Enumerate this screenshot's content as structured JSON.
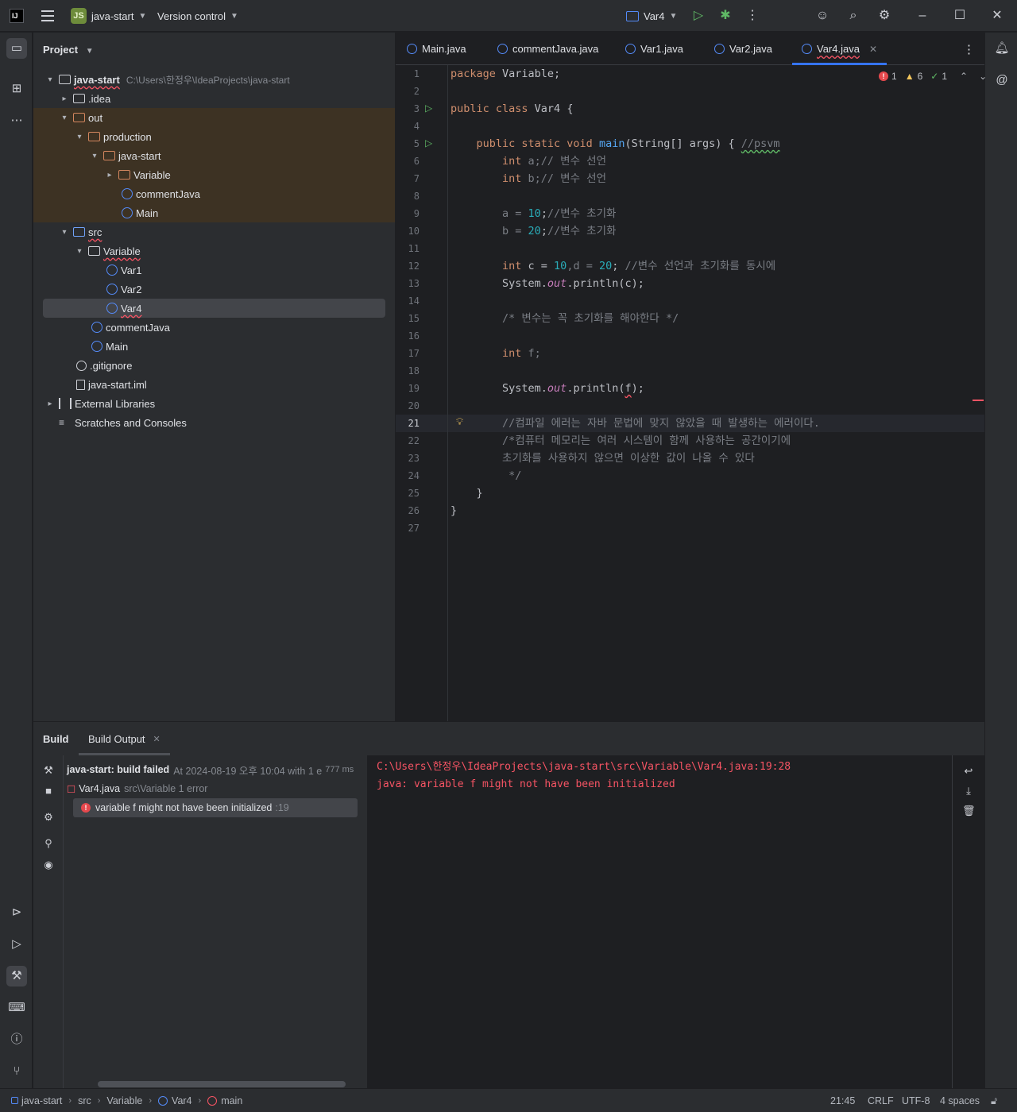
{
  "titlebar": {
    "app_logo": "IJ",
    "project_badge": "JS",
    "project_name": "java-start",
    "vcs_label": "Version control",
    "run_config": "Var4"
  },
  "project_panel": {
    "header": "Project",
    "root_name": "java-start",
    "root_path": "C:\\Users\\한정우\\IdeaProjects\\java-start",
    "items": [
      {
        "label": ".idea",
        "type": "folder"
      },
      {
        "label": "out",
        "type": "folder"
      },
      {
        "label": "production",
        "type": "folder"
      },
      {
        "label": "java-start",
        "type": "folder"
      },
      {
        "label": "Variable",
        "type": "folder"
      },
      {
        "label": "commentJava",
        "type": "class"
      },
      {
        "label": "Main",
        "type": "class"
      },
      {
        "label": "src",
        "type": "folder"
      },
      {
        "label": "Variable",
        "type": "package"
      },
      {
        "label": "Var1",
        "type": "class"
      },
      {
        "label": "Var2",
        "type": "class"
      },
      {
        "label": "Var4",
        "type": "class"
      },
      {
        "label": "commentJava",
        "type": "class"
      },
      {
        "label": "Main",
        "type": "class"
      },
      {
        "label": ".gitignore",
        "type": "file"
      },
      {
        "label": "java-start.iml",
        "type": "file"
      },
      {
        "label": "External Libraries",
        "type": "library"
      },
      {
        "label": "Scratches and Consoles",
        "type": "scratches"
      }
    ]
  },
  "editor": {
    "tabs": [
      "Main.java",
      "commentJava.java",
      "Var1.java",
      "Var2.java",
      "Var4.java"
    ],
    "active_tab": "Var4.java",
    "inspections": {
      "errors": "1",
      "warnings": "6",
      "ok": "1"
    },
    "line_numbers": [
      "1",
      "2",
      "3",
      "4",
      "5",
      "6",
      "7",
      "8",
      "9",
      "10",
      "11",
      "12",
      "13",
      "14",
      "15",
      "16",
      "17",
      "18",
      "19",
      "20",
      "21",
      "22",
      "23",
      "24",
      "25",
      "26",
      "27"
    ],
    "current_line": "21",
    "code": {
      "l1_a": "package",
      "l1_b": " Variable;",
      "l3_a": "public class",
      "l3_b": " Var4 {",
      "l5_a": "    public static void ",
      "l5_b": "main",
      "l5_c": "(String[] args) { ",
      "l5_d": "//psvm",
      "l6_a": "        int",
      "l6_b": " a;",
      "l6_c": "// 변수 선언",
      "l7_a": "        int",
      "l7_b": " b;",
      "l7_c": "// 변수 선언",
      "l9_a": "        a = ",
      "l9_b": "10",
      "l9_c": ";",
      "l9_d": "//변수 초기화",
      "l10_a": "        b = ",
      "l10_b": "20",
      "l10_c": ";",
      "l10_d": "//변수 초기화",
      "l12_a": "        int",
      "l12_b": " c = ",
      "l12_c": "10",
      "l12_d": ",d = ",
      "l12_e": "20",
      "l12_f": "; ",
      "l12_g": "//변수 선언과 초기화를 동시에",
      "l13_a": "        System.",
      "l13_b": "out",
      "l13_c": ".println(c);",
      "l15": "        /* 변수는 꼭 초기화를 해야한다 */",
      "l17_a": "        int",
      "l17_b": " f;",
      "l19_a": "        System.",
      "l19_b": "out",
      "l19_c": ".println(",
      "l19_d": "f",
      "l19_e": ");",
      "l21": "        //컴파일 에러는 자바 문법에 맞지 않았을 때 발생하는 에러이다.",
      "l22": "        /*컴퓨터 메모리는 여러 시스템이 함께 사용하는 공간이기에",
      "l23": "        초기화를 사용하지 않으면 이상한 값이 나올 수 있다",
      "l24": "         */",
      "l25": "    }",
      "l26": "}"
    }
  },
  "build": {
    "tab_build": "Build",
    "tab_output": "Build Output",
    "summary_title": "java-start: build failed",
    "summary_detail": "At 2024-08-19 오후 10:04 with 1 e",
    "summary_time": "777 ms",
    "file_label": "Var4.java",
    "file_path": "src\\Variable 1 error",
    "error_msg": "variable f might not have been initialized",
    "error_line": ":19",
    "output_lines": [
      "C:\\Users\\한정우\\IdeaProjects\\java-start\\src\\Variable\\Var4.java:19:28",
      "java: variable f might not have been initialized"
    ]
  },
  "statusbar": {
    "crumbs": [
      "java-start",
      "src",
      "Variable",
      "Var4",
      "main"
    ],
    "position": "21:45",
    "line_sep": "CRLF",
    "encoding": "UTF-8",
    "indent": "4 spaces"
  },
  "colors": {
    "accent": "#3574f0",
    "error": "#f75464",
    "run_green": "#5fb865",
    "out_highlight": "#3d3223"
  }
}
